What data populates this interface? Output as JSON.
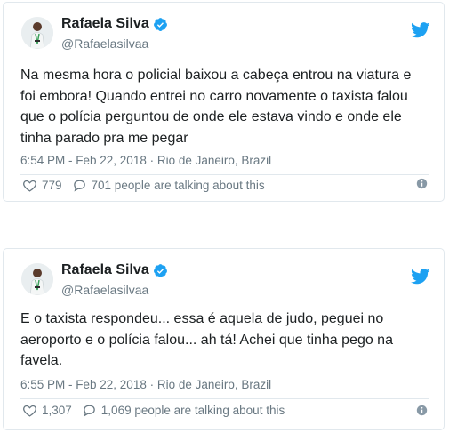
{
  "colors": {
    "name": "#1c2022",
    "muted": "#697882",
    "twitter_blue": "#1da1f2",
    "border": "#e1e8ed"
  },
  "tweets": [
    {
      "author": {
        "name": "Rafaela Silva",
        "handle": "@Rafaelasilvaa",
        "verified": true
      },
      "text": "Na mesma hora o policial baixou a cabeça entrou na viatura e foi embora! Quando entrei no carro novamente o taxista falou que o polícia perguntou de onde ele estava vindo e onde ele tinha parado pra me pegar",
      "timestamp": "6:54 PM - Feb 22, 2018",
      "location": "Rio de Janeiro, Brazil",
      "likes": "779",
      "talking": "701 people are talking about this"
    },
    {
      "author": {
        "name": "Rafaela Silva",
        "handle": "@Rafaelasilvaa",
        "verified": true
      },
      "text": "E o taxista respondeu... essa é aquela de judo, peguei no aeroporto e o polícia falou... ah tá! Achei que tinha pego na favela.",
      "timestamp": "6:55 PM - Feb 22, 2018",
      "location": "Rio de Janeiro, Brazil",
      "likes": "1,307",
      "talking": "1,069 people are talking about this"
    }
  ],
  "separator": "·",
  "icons": [
    "avatar-photo",
    "verified-badge-icon",
    "twitter-bird-icon",
    "heart-icon",
    "speech-bubble-icon",
    "info-icon"
  ]
}
